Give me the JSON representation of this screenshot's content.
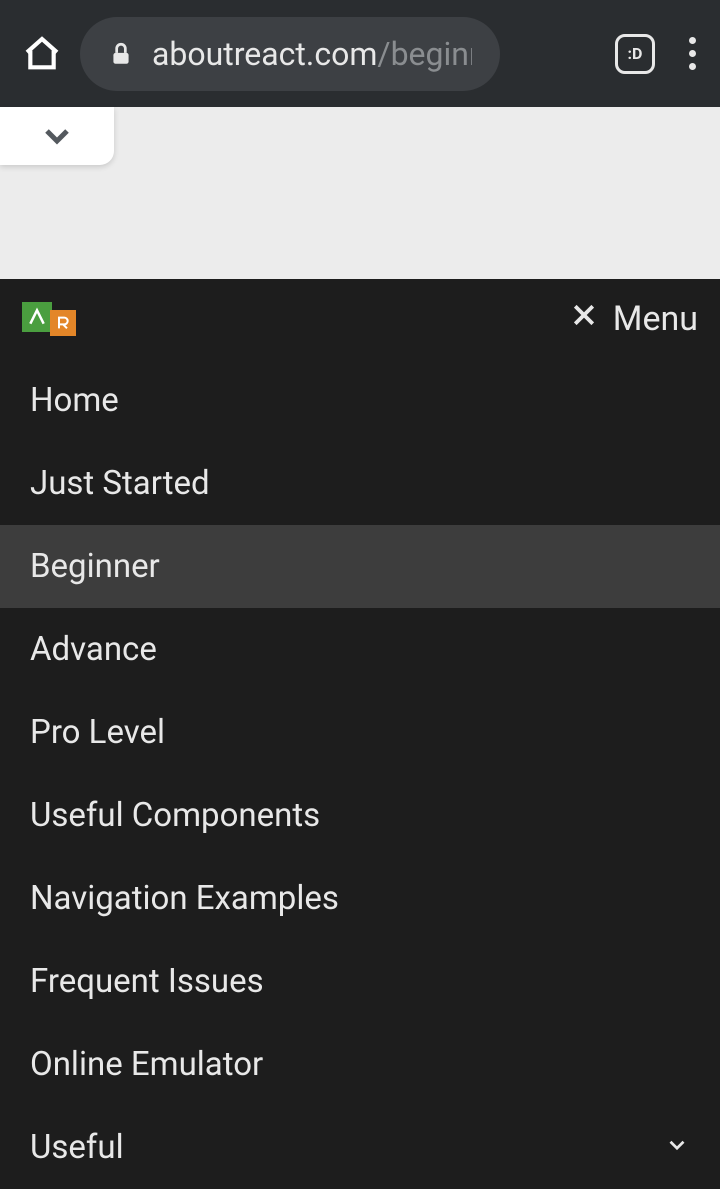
{
  "browser": {
    "url_domain": "aboutreact.com",
    "url_path": "/beginr",
    "d_label": ":D"
  },
  "header": {
    "menu_label": "Menu"
  },
  "nav": {
    "items": [
      {
        "label": "Home",
        "active": false,
        "has_submenu": false
      },
      {
        "label": "Just Started",
        "active": false,
        "has_submenu": false
      },
      {
        "label": "Beginner",
        "active": true,
        "has_submenu": false
      },
      {
        "label": "Advance",
        "active": false,
        "has_submenu": false
      },
      {
        "label": "Pro Level",
        "active": false,
        "has_submenu": false
      },
      {
        "label": "Useful Components",
        "active": false,
        "has_submenu": false
      },
      {
        "label": "Navigation Examples",
        "active": false,
        "has_submenu": false
      },
      {
        "label": "Frequent Issues",
        "active": false,
        "has_submenu": false
      },
      {
        "label": "Online Emulator",
        "active": false,
        "has_submenu": false
      },
      {
        "label": "Useful",
        "active": false,
        "has_submenu": true
      }
    ]
  }
}
